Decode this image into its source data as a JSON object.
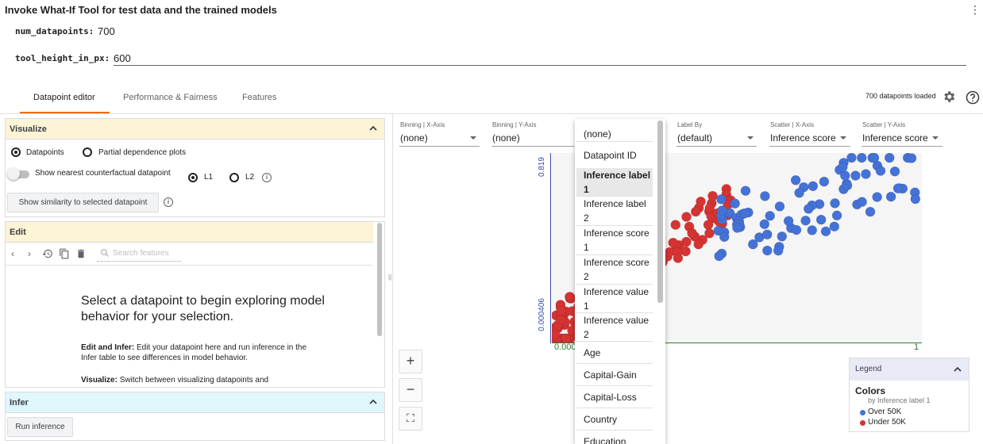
{
  "window": {
    "title": "Invoke What-If Tool for test data and the trained models"
  },
  "params": [
    {
      "name": "num_datapoints:",
      "value": "700"
    },
    {
      "name": "tool_height_in_px:",
      "value": "600"
    }
  ],
  "tabs": [
    {
      "label": "Datapoint editor",
      "active": true
    },
    {
      "label": "Performance & Fairness",
      "active": false
    },
    {
      "label": "Features",
      "active": false
    }
  ],
  "status": {
    "loaded": "700 datapoints loaded"
  },
  "visualize": {
    "title": "Visualize",
    "option_datapoints": "Datapoints",
    "option_pdp": "Partial dependence plots",
    "nearest_label": "Show nearest counterfactual datapoint",
    "l1": "L1",
    "l2": "L2",
    "similarity_button": "Show similarity to selected datapoint"
  },
  "edit": {
    "title": "Edit",
    "search_placeholder": "Search features",
    "headline": "Select a datapoint to begin exploring model behavior for your selection.",
    "help_edit_title": "Edit and Infer:",
    "help_edit_body": " Edit your datapoint here and run inference in the Infer table to see differences in model behavior.",
    "help_vis_title": "Visualize:",
    "help_vis_body": " Switch between visualizing datapoints and"
  },
  "infer": {
    "title": "Infer",
    "run_button": "Run inference"
  },
  "controls": [
    {
      "label": "Binning | X-Axis",
      "value": "(none)",
      "color": "#e65100"
    },
    {
      "label": "Binning | Y-Axis",
      "value": "(none)",
      "color": "#5f6368"
    },
    {
      "label": "Label By",
      "value": "(default)",
      "color": "#202124"
    },
    {
      "label": "Scatter | X-Axis",
      "value": "Inference score",
      "color": "#2e7d32"
    },
    {
      "label": "Scatter | Y-Axis",
      "value": "Inference score",
      "color": "#3949ab"
    }
  ],
  "dropdown": {
    "items": [
      "(none)",
      "Datapoint ID",
      "Inference label 1",
      "Inference label 2",
      "Inference score 1",
      "Inference score 2",
      "Inference value 1",
      "Inference value 2",
      "Age",
      "Capital-Gain",
      "Capital-Loss",
      "Country",
      "Education"
    ],
    "selected": "Inference label 1"
  },
  "plot": {
    "y_top": "0.819",
    "y_bottom": "0.000406",
    "x_left": "0.000",
    "x_right": "1",
    "colors": {
      "over": "#4472d6",
      "under": "#d63333"
    }
  },
  "zoom": {
    "in": "+",
    "out": "−",
    "fit": "⛶"
  },
  "legend": {
    "title": "Legend",
    "colors_title": "Colors",
    "subtitle": "by Inference label 1",
    "items": [
      {
        "label": "Over 50K",
        "color": "#4472d6"
      },
      {
        "label": "Under 50K",
        "color": "#d63333"
      }
    ]
  },
  "icons": {
    "gear": "gear-icon",
    "help": "help-icon",
    "kebab": "more-vert-icon"
  }
}
